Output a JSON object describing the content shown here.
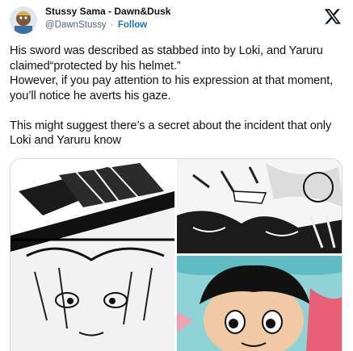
{
  "author": {
    "name": "Stussy Sama - Dawn&Dusk",
    "handle": "@DawnStussy",
    "separator": "·",
    "follow_label": "Follow"
  },
  "tweet": {
    "text": "His sword was described as stabbed into by Loki, and Yaruru claimed“protected by his helmet.”\nHowever, if you pay attention to his expression at that moment, you’ll notice he averts his gaze.\n\nThis might suggest there’s a secret about the incident that only Loki and Yaruru know"
  },
  "colors": {
    "text": "#0f1419",
    "secondary": "#536471",
    "follow": "#1d72b8",
    "border": "#cfd9de"
  },
  "icons": {
    "brand": "x-logo-icon",
    "avatar": "avatar-image"
  }
}
